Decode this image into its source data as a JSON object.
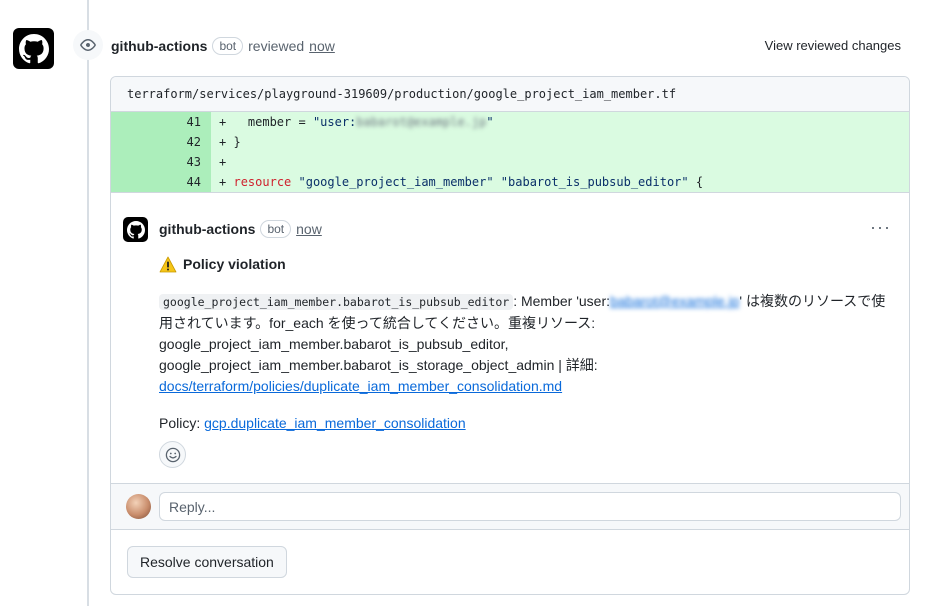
{
  "review": {
    "author": "github-actions",
    "bot_label": "bot",
    "action": "reviewed",
    "time": "now",
    "view_changes_label": "View reviewed changes"
  },
  "file": {
    "path": "terraform/services/playground-319609/production/google_project_iam_member.tf",
    "lines": [
      {
        "num": "41",
        "prefix": "+",
        "code_plain": "   member = ",
        "code_str": "\"user:",
        "code_redacted": "babarot@example.jp",
        "code_str_end": "\""
      },
      {
        "num": "42",
        "prefix": "+",
        "code_plain": " }"
      },
      {
        "num": "43",
        "prefix": "+",
        "code_plain": ""
      },
      {
        "num": "44",
        "prefix": "+",
        "code_kw": "resource",
        "code_str": "\"google_project_iam_member\" \"babarot_is_pubsub_editor\"",
        "code_plain_end": " {"
      }
    ]
  },
  "comment": {
    "author": "github-actions",
    "bot_label": "bot",
    "time": "now",
    "menu_label": "···",
    "title": "Policy violation",
    "code_ref": "google_project_iam_member.babarot_is_pubsub_editor",
    "text_member_prefix": ": Member 'user:",
    "redacted_user": "babarot@example.jp",
    "text_after_user": "' は複数のリソースで使用されています。for_each を使って統合してください。重複リソース: google_project_iam_member.babarot_is_pubsub_editor, google_project_iam_member.babarot_is_storage_object_admin | 詳細: ",
    "doc_link": "docs/terraform/policies/duplicate_iam_member_consolidation.md",
    "policy_label": "Policy: ",
    "policy_link": "gcp.duplicate_iam_member_consolidation"
  },
  "reply": {
    "placeholder": "Reply..."
  },
  "resolve_label": "Resolve conversation",
  "colors": {
    "diff_num_bg": "#aceebb",
    "diff_code_bg": "#dafbe1",
    "link": "#0969da",
    "keyword": "#cf222e",
    "string": "#0a3069"
  }
}
